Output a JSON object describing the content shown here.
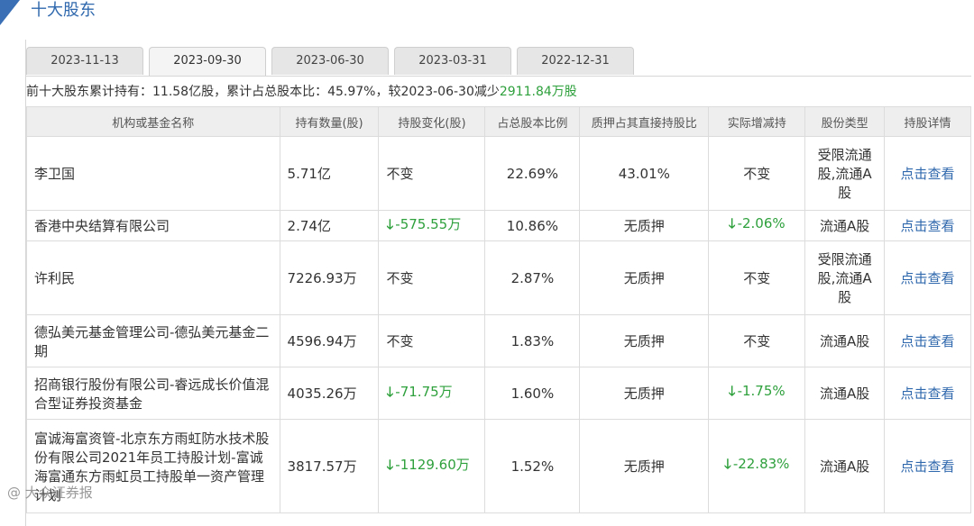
{
  "header": {
    "title": "十大股东"
  },
  "tabs": [
    {
      "label": "2023-11-13",
      "active": false
    },
    {
      "label": "2023-09-30",
      "active": true
    },
    {
      "label": "2023-06-30",
      "active": false
    },
    {
      "label": "2023-03-31",
      "active": false
    },
    {
      "label": "2022-12-31",
      "active": false
    }
  ],
  "summary": {
    "prefix": "前十大股东累计持有：",
    "total_holding": "11.58亿股",
    "sep1": "，累计占总股本比：",
    "total_ratio": "45.97%",
    "sep2": "，较",
    "compare_date": "2023-06-30",
    "change_word": "减少",
    "change_amount": "2911.84万股"
  },
  "columns": [
    "机构或基金名称",
    "持有数量(股)",
    "持股变化(股)",
    "占总股本比例",
    "质押占其直接持股比",
    "实际增减持",
    "股份类型",
    "持股详情"
  ],
  "rows": [
    {
      "name": "李卫国",
      "qty": "5.71亿",
      "change": "不变",
      "change_dir": "",
      "ratio": "22.69%",
      "pledge": "43.01%",
      "actual": "不变",
      "actual_dir": "",
      "type": "受限流通股,流通A股",
      "detail": "点击查看"
    },
    {
      "name": "香港中央结算有限公司",
      "qty": "2.74亿",
      "change": "-575.55万",
      "change_dir": "down",
      "ratio": "10.86%",
      "pledge": "无质押",
      "actual": "-2.06%",
      "actual_dir": "down",
      "type": "流通A股",
      "detail": "点击查看"
    },
    {
      "name": "许利民",
      "qty": "7226.93万",
      "change": "不变",
      "change_dir": "",
      "ratio": "2.87%",
      "pledge": "无质押",
      "actual": "不变",
      "actual_dir": "",
      "type": "受限流通股,流通A股",
      "detail": "点击查看"
    },
    {
      "name": "德弘美元基金管理公司-德弘美元基金二期",
      "qty": "4596.94万",
      "change": "不变",
      "change_dir": "",
      "ratio": "1.83%",
      "pledge": "无质押",
      "actual": "不变",
      "actual_dir": "",
      "type": "流通A股",
      "detail": "点击查看"
    },
    {
      "name": "招商银行股份有限公司-睿远成长价值混合型证券投资基金",
      "qty": "4035.26万",
      "change": "-71.75万",
      "change_dir": "down",
      "ratio": "1.60%",
      "pledge": "无质押",
      "actual": "-1.75%",
      "actual_dir": "down",
      "type": "流通A股",
      "detail": "点击查看"
    },
    {
      "name": "富诚海富资管-北京东方雨虹防水技术股份有限公司2021年员工持股计划-富诚海富通东方雨虹员工持股单一资产管理计划",
      "qty": "3817.57万",
      "change": "-1129.60万",
      "change_dir": "down",
      "ratio": "1.52%",
      "pledge": "无质押",
      "actual": "-22.83%",
      "actual_dir": "down",
      "type": "流通A股",
      "detail": "点击查看"
    }
  ],
  "watermark": "@ 大众证券报"
}
